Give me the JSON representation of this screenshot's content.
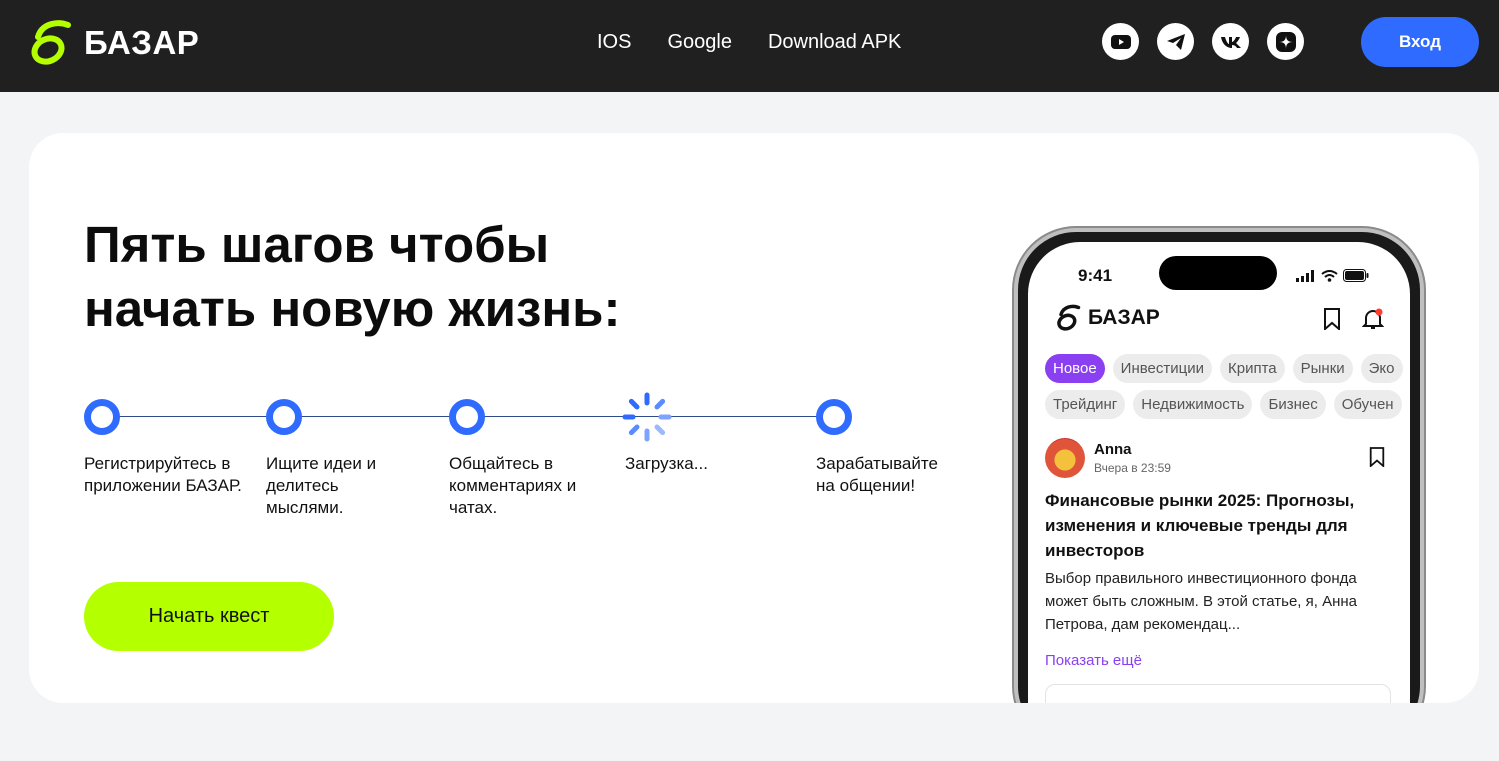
{
  "header": {
    "logo_text": "БАЗАР",
    "nav": [
      "IOS",
      "Google",
      "Download APK"
    ],
    "socials": [
      "youtube-icon",
      "telegram-icon",
      "vk-icon",
      "dzen-icon"
    ],
    "login_label": "Вход"
  },
  "hero": {
    "headline_line1": "Пять шагов чтобы",
    "headline_line2": "начать новую жизнь:",
    "steps": [
      {
        "label": "Регистрируйтесь в приложении БАЗАР.",
        "state": "done"
      },
      {
        "label": "Ищите идеи и делитесь мыслями.",
        "state": "done"
      },
      {
        "label": "Общайтесь в комментариях и чатах.",
        "state": "done"
      },
      {
        "label": "Загрузка...",
        "state": "loading"
      },
      {
        "label": "Зарабатывайте на общении!",
        "state": "done"
      }
    ],
    "cta_label": "Начать квест"
  },
  "phone": {
    "time": "9:41",
    "app_logo_text": "БАЗАР",
    "chips_row1": [
      "Новое",
      "Инвестиции",
      "Крипта",
      "Рынки",
      "Эко"
    ],
    "chips_row2": [
      "Трейдинг",
      "Недвижимость",
      "Бизнес",
      "Обучен"
    ],
    "post": {
      "author": "Anna",
      "time": "Вчера в 23:59",
      "title": "Финансовые рынки 2025: Прогнозы, изменения и ключевые тренды для инвесторов",
      "text": "Выбор правильного инвестиционного фонда может быть сложным. В этой статье, я, Анна Петрова, дам рекомендац...",
      "show_more": "Показать ещё"
    }
  },
  "colors": {
    "header_bg": "#202020",
    "accent_blue": "#2f6bff",
    "accent_lime": "#b4ff00",
    "accent_purple": "#8a3ff0"
  }
}
